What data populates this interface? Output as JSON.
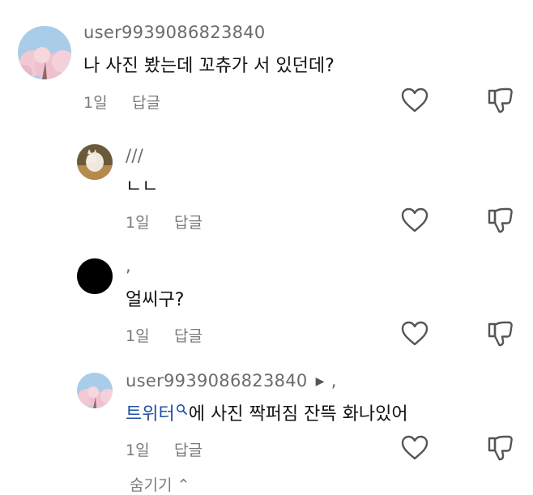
{
  "comments": [
    {
      "username": "user9939086823840",
      "text": "나 사진 봤는데 꼬츄가 서 있던데?",
      "time": "1일",
      "reply_label": "답글",
      "avatar": "cherry-blossom-avatar"
    },
    {
      "username": "///",
      "text": "ㄴㄴ",
      "time": "1일",
      "reply_label": "답글",
      "avatar": "cat-avatar"
    },
    {
      "username": ",",
      "text": "얼씨구?",
      "time": "1일",
      "reply_label": "답글",
      "avatar": "black-avatar"
    },
    {
      "username": "user9939086823840",
      "reply_to": ",",
      "text_link": "트위터",
      "text_rest": "에 사진 짝퍼짐 잔뜩 화나있어",
      "time": "1일",
      "reply_label": "답글",
      "avatar": "cherry-blossom-avatar"
    }
  ],
  "hide_replies_label": "숨기기 ⌃",
  "icons": {
    "like": "heart-outline-icon",
    "dislike": "thumbs-down-icon",
    "search": "search-icon",
    "reply_arrow": "triangle-right-icon"
  }
}
